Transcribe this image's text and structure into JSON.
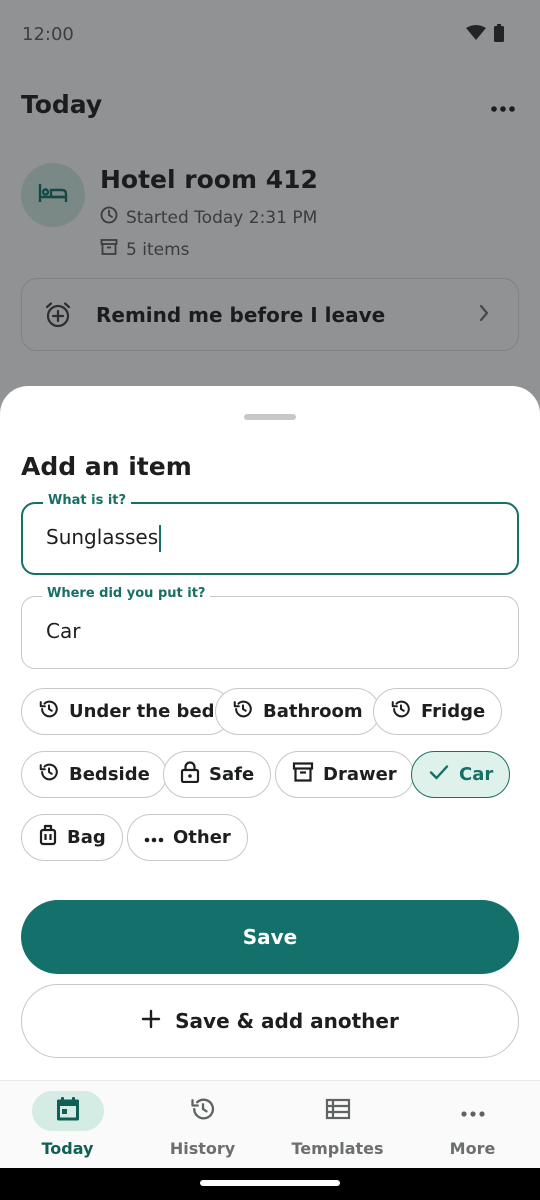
{
  "status_bar": {
    "time": "12:00"
  },
  "header": {
    "title": "Today"
  },
  "session": {
    "title": "Hotel room 412",
    "started": "Started Today 2:31 PM",
    "items_count": "5 items"
  },
  "remind": {
    "label": "Remind me before I leave"
  },
  "sheet": {
    "title": "Add an item",
    "what_field": {
      "label": "What is it?",
      "value": "Sunglasses"
    },
    "where_field": {
      "label": "Where did you put it?",
      "value": "Car"
    },
    "chips": [
      {
        "label": "Under the bed",
        "icon": "history-icon",
        "selected": false
      },
      {
        "label": "Bathroom",
        "icon": "history-icon",
        "selected": false
      },
      {
        "label": "Fridge",
        "icon": "history-icon",
        "selected": false
      },
      {
        "label": "Bedside",
        "icon": "history-icon",
        "selected": false
      },
      {
        "label": "Safe",
        "icon": "lock-icon",
        "selected": false
      },
      {
        "label": "Drawer",
        "icon": "archive-icon",
        "selected": false
      },
      {
        "label": "Car",
        "icon": "check-icon",
        "selected": true
      },
      {
        "label": "Bag",
        "icon": "luggage-icon",
        "selected": false
      },
      {
        "label": "Other",
        "icon": "more-horizontal-icon",
        "selected": false
      }
    ],
    "save_label": "Save",
    "save_add_label": "Save & add another"
  },
  "nav": {
    "items": [
      {
        "label": "Today",
        "icon": "calendar-icon",
        "active": true
      },
      {
        "label": "History",
        "icon": "history-icon",
        "active": false
      },
      {
        "label": "Templates",
        "icon": "list-icon",
        "active": false
      },
      {
        "label": "More",
        "icon": "more-horizontal-icon",
        "active": false
      }
    ]
  },
  "colors": {
    "primary": "#13706a",
    "primary_container": "#def1ea",
    "avatar_bg": "#cde6dd",
    "scrim": "#191c1e"
  }
}
